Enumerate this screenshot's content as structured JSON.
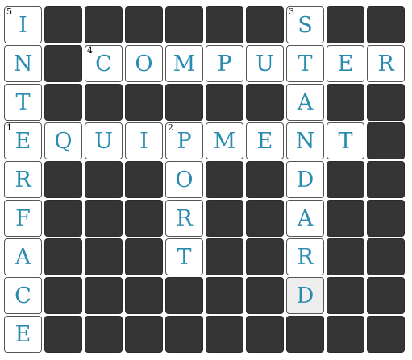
{
  "puzzle": {
    "colors": {
      "letter": "#2a8bb1",
      "block": "#353535",
      "cell": "#ffffff",
      "active_cell": "#eeeeee"
    },
    "active_cell": [
      7,
      7
    ],
    "grid": [
      [
        {
          "l": "I",
          "n": "5"
        },
        null,
        null,
        null,
        null,
        null,
        null,
        {
          "l": "S",
          "n": "3"
        },
        null,
        null
      ],
      [
        {
          "l": "N"
        },
        null,
        {
          "l": "C",
          "n": "4"
        },
        {
          "l": "O"
        },
        {
          "l": "M"
        },
        {
          "l": "P"
        },
        {
          "l": "U"
        },
        {
          "l": "T"
        },
        {
          "l": "E"
        },
        {
          "l": "R"
        }
      ],
      [
        {
          "l": "T"
        },
        null,
        null,
        null,
        null,
        null,
        null,
        {
          "l": "A"
        },
        null,
        null
      ],
      [
        {
          "l": "E",
          "n": "1"
        },
        {
          "l": "Q"
        },
        {
          "l": "U"
        },
        {
          "l": "I"
        },
        {
          "l": "P",
          "n": "2"
        },
        {
          "l": "M"
        },
        {
          "l": "E"
        },
        {
          "l": "N"
        },
        {
          "l": "T"
        },
        null
      ],
      [
        {
          "l": "R"
        },
        null,
        null,
        null,
        {
          "l": "O"
        },
        null,
        null,
        {
          "l": "D"
        },
        null,
        null
      ],
      [
        {
          "l": "F"
        },
        null,
        null,
        null,
        {
          "l": "R"
        },
        null,
        null,
        {
          "l": "A"
        },
        null,
        null
      ],
      [
        {
          "l": "A"
        },
        null,
        null,
        null,
        {
          "l": "T"
        },
        null,
        null,
        {
          "l": "R"
        },
        null,
        null
      ],
      [
        {
          "l": "C"
        },
        null,
        null,
        null,
        null,
        null,
        null,
        {
          "l": "D"
        },
        null,
        null
      ],
      [
        {
          "l": "E"
        },
        null,
        null,
        null,
        null,
        null,
        null,
        null,
        null,
        null
      ]
    ]
  }
}
